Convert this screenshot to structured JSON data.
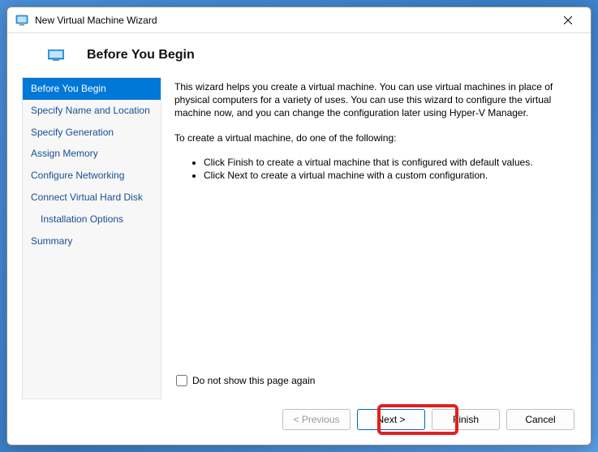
{
  "window": {
    "title": "New Virtual Machine Wizard"
  },
  "header": {
    "title": "Before You Begin"
  },
  "sidebar": {
    "items": [
      {
        "label": "Before You Begin",
        "selected": true
      },
      {
        "label": "Specify Name and Location"
      },
      {
        "label": "Specify Generation"
      },
      {
        "label": "Assign Memory"
      },
      {
        "label": "Configure Networking"
      },
      {
        "label": "Connect Virtual Hard Disk"
      },
      {
        "label": "Installation Options",
        "indented": true
      },
      {
        "label": "Summary"
      }
    ]
  },
  "main": {
    "intro": "This wizard helps you create a virtual machine. You can use virtual machines in place of physical computers for a variety of uses. You can use this wizard to configure the virtual machine now, and you can change the configuration later using Hyper-V Manager.",
    "instruction": "To create a virtual machine, do one of the following:",
    "bullets": [
      "Click Finish to create a virtual machine that is configured with default values.",
      "Click Next to create a virtual machine with a custom configuration."
    ],
    "checkbox_label": "Do not show this page again"
  },
  "footer": {
    "previous": "< Previous",
    "next": "Next >",
    "finish": "Finish",
    "cancel": "Cancel"
  }
}
